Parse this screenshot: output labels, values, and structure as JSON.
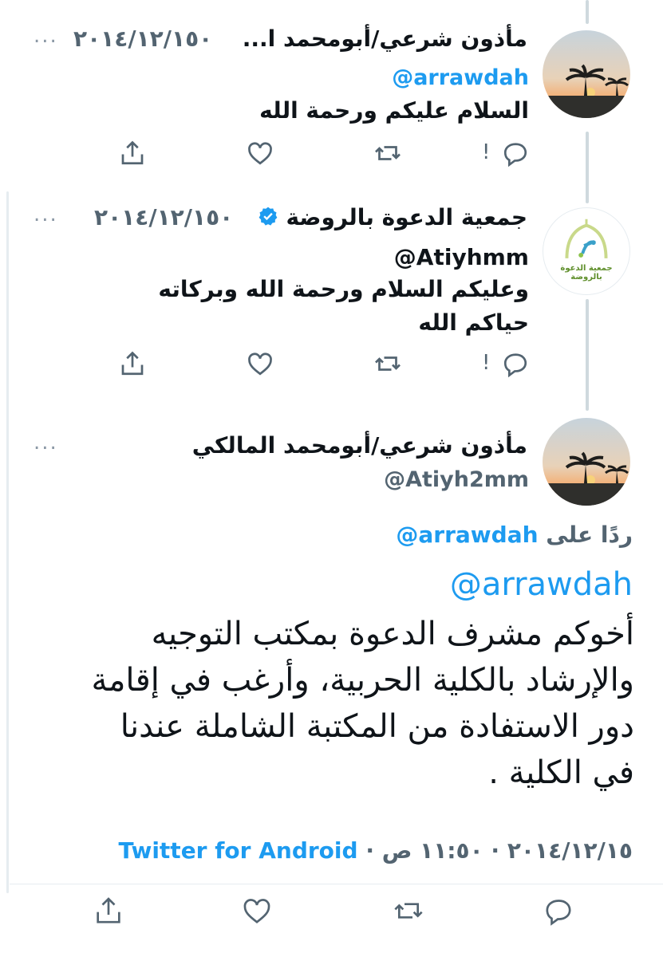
{
  "tweets": [
    {
      "name": "مأذون شرعي/أبومحمد ا...",
      "date": "٢٠١٤/١٢/١٥٠",
      "handle": "@arrawdah",
      "text": "السلام عليكم ورحمة الله"
    },
    {
      "name": "جمعية الدعوة بالروضة",
      "date": "٢٠١٤/١٢/١٥٠",
      "handle": "Atiyhmm@",
      "lines": [
        "وعليكم السلام ورحمة الله وبركاته",
        "حياكم الله"
      ],
      "logo_text": "جمعية الدعوة بالروضة"
    }
  ],
  "main_tweet": {
    "name": "مأذون شرعي/أبومحمد المالكي",
    "handle": "@Atiyh2mm",
    "reply_prefix": "ردًا على",
    "reply_to": "@arrawdah",
    "mention": "@arrawdah",
    "lines": [
      "أخوكم مشرف الدعوة بمكتب التوجيه",
      "والإرشاد بالكلية الحربية، وأرغب في إقامة",
      "دور الاستفادة من المكتبة الشاملة عندنا",
      "في الكلية ."
    ],
    "meta_time": "٢٠١٤/١٢/١٥ · ١١:٥٠ ص ·",
    "meta_source": "Twitter for Android"
  },
  "more_label": "...",
  "colors": {
    "link": "#1d9bf0",
    "muted": "#536471",
    "verified": "#1d9bf0",
    "line": "#cfd9de"
  },
  "icons": [
    "reply-icon",
    "retweet-icon",
    "like-icon",
    "share-icon",
    "verified-icon",
    "more-icon"
  ]
}
